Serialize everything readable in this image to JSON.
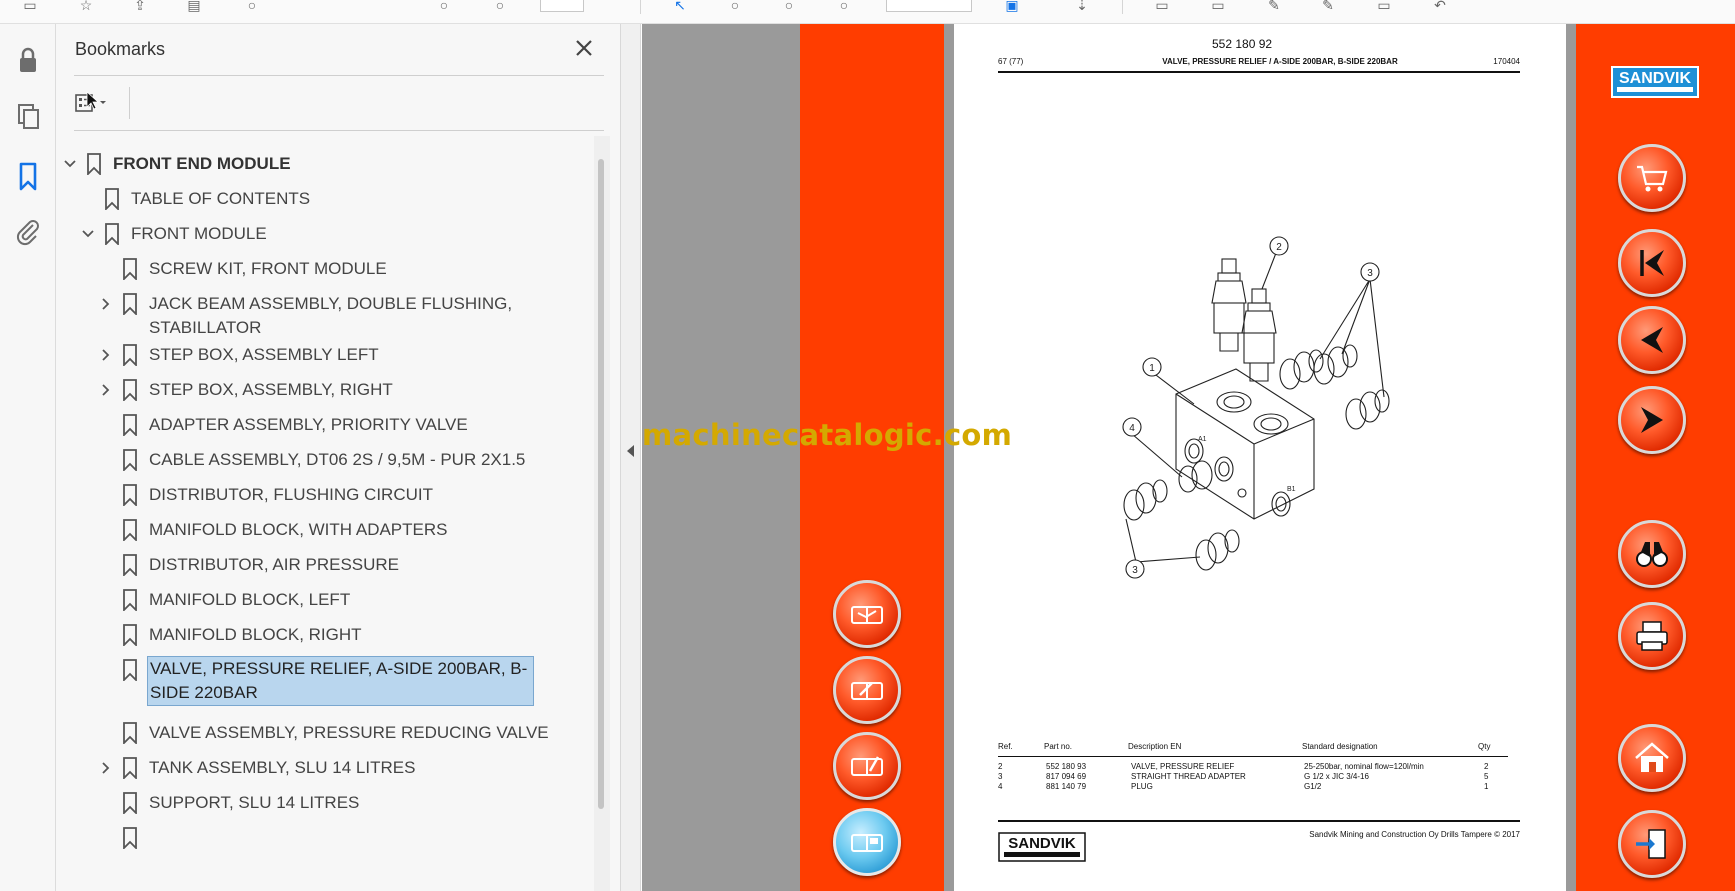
{
  "bookmarks_panel": {
    "title": "Bookmarks",
    "items": [
      {
        "label": "FRONT END MODULE",
        "level": 0,
        "expanded": true,
        "bold": true
      },
      {
        "label": "TABLE OF CONTENTS",
        "level": 1
      },
      {
        "label": "FRONT MODULE",
        "level": 1,
        "expanded": true
      },
      {
        "label": "SCREW KIT, FRONT MODULE",
        "level": 2
      },
      {
        "label": "JACK BEAM ASSEMBLY, DOUBLE FLUSHING, STABILLATOR",
        "level": 2,
        "collapsed": true
      },
      {
        "label": "STEP BOX, ASSEMBLY LEFT",
        "level": 2,
        "collapsed": true
      },
      {
        "label": "STEP BOX, ASSEMBLY, RIGHT",
        "level": 2,
        "collapsed": true
      },
      {
        "label": "ADAPTER ASSEMBLY, PRIORITY VALVE",
        "level": 2
      },
      {
        "label": "CABLE ASSEMBLY, DT06 2S / 9,5M - PUR 2X1.5",
        "level": 2
      },
      {
        "label": "DISTRIBUTOR, FLUSHING CIRCUIT",
        "level": 2
      },
      {
        "label": "MANIFOLD BLOCK, WITH ADAPTERS",
        "level": 2
      },
      {
        "label": "DISTRIBUTOR, AIR PRESSURE",
        "level": 2
      },
      {
        "label": "MANIFOLD BLOCK, LEFT",
        "level": 2
      },
      {
        "label": "MANIFOLD BLOCK, RIGHT",
        "level": 2
      },
      {
        "label": "VALVE, PRESSURE RELIEF, A-SIDE 200BAR, B-SIDE 220BAR",
        "level": 2,
        "selected": true
      },
      {
        "label": "VALVE ASSEMBLY, PRESSURE REDUCING VALVE",
        "level": 2
      },
      {
        "label": "TANK ASSEMBLY, SLU 14 LITRES",
        "level": 2,
        "collapsed": true
      },
      {
        "label": "SUPPORT, SLU 14 LITRES",
        "level": 2
      }
    ]
  },
  "watermark": "machinecatalogic.com",
  "page": {
    "part_number": "552 180 92",
    "page_number": "67 (77)",
    "title": "VALVE, PRESSURE RELIEF / A-SIDE 200BAR, B-SIDE 220BAR",
    "code": "170404",
    "callouts": [
      "1",
      "2",
      "3",
      "4",
      "3",
      "3"
    ],
    "block_labels": [
      "A1",
      "B1"
    ],
    "table": {
      "headers": [
        "Ref.",
        "Part no.",
        "Description EN",
        "Standard designation",
        "Qty"
      ],
      "rows": [
        [
          "2",
          "552 180 93",
          "VALVE, PRESSURE RELIEF",
          "25-250bar, nominal flow=120l/min",
          "2"
        ],
        [
          "3",
          "817 094 69",
          "STRAIGHT THREAD ADAPTER",
          "G 1/2 x JIC 3/4-16",
          "5"
        ],
        [
          "4",
          "881 140 79",
          "PLUG",
          "G1/2",
          "1"
        ]
      ]
    },
    "footer_logo": "SANDVIK",
    "copyright": "Sandvik Mining and Construction Oy Drills Tampere © 2017"
  },
  "right_logo": "SANDVIK",
  "colors": {
    "accent_red": "#ff3d00",
    "selection": "#b9d6ee",
    "viewer_gray": "#9a9a9a",
    "bookmark_blue": "#1473e6"
  }
}
